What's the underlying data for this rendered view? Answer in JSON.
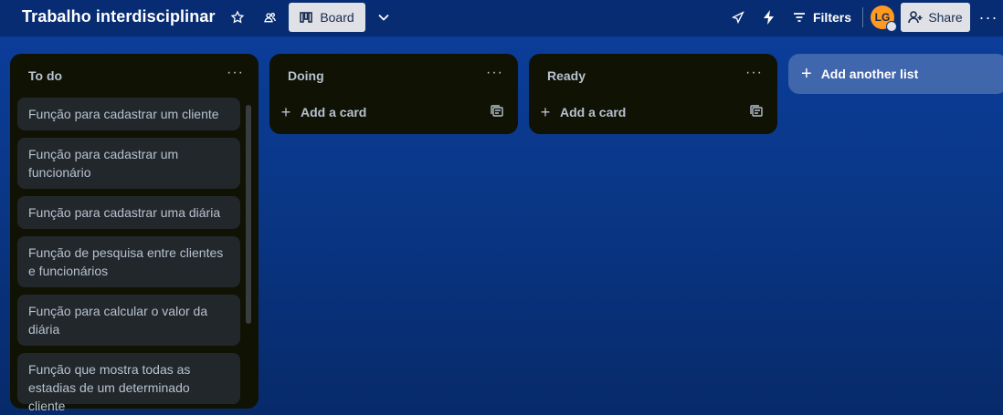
{
  "header": {
    "board_title": "Trabalho interdisciplinar",
    "view_label": "Board",
    "filters_label": "Filters",
    "avatar_initials": "LG",
    "share_label": "Share",
    "icons": {
      "star": "star-icon",
      "workspace": "workspace-visibility-icon",
      "board_view": "board-view-icon",
      "chevron": "chevron-down-icon",
      "power_ups": "rocket-icon",
      "automation": "lightning-icon",
      "filter": "filter-icon",
      "share": "add-person-icon",
      "more": "more-icon"
    }
  },
  "lists": [
    {
      "title": "To do",
      "cards": [
        "Função para cadastrar um cliente",
        "Função para cadastrar um funcionário",
        "Função para cadastrar uma diária",
        "Função de pesquisa entre clientes e funcionários",
        "Função para calcular o valor da diária",
        "Função que mostra todas as estadias de um determinado cliente"
      ]
    },
    {
      "title": "Doing",
      "add_card_label": "Add a card"
    },
    {
      "title": "Ready",
      "add_card_label": "Add a card"
    }
  ],
  "add_list_label": "Add another list",
  "colors": {
    "background": "#0a3788",
    "list_bg": "#101204",
    "card_bg": "#22272b",
    "text_muted": "#b6c2cf",
    "avatar": "#ff991f"
  }
}
